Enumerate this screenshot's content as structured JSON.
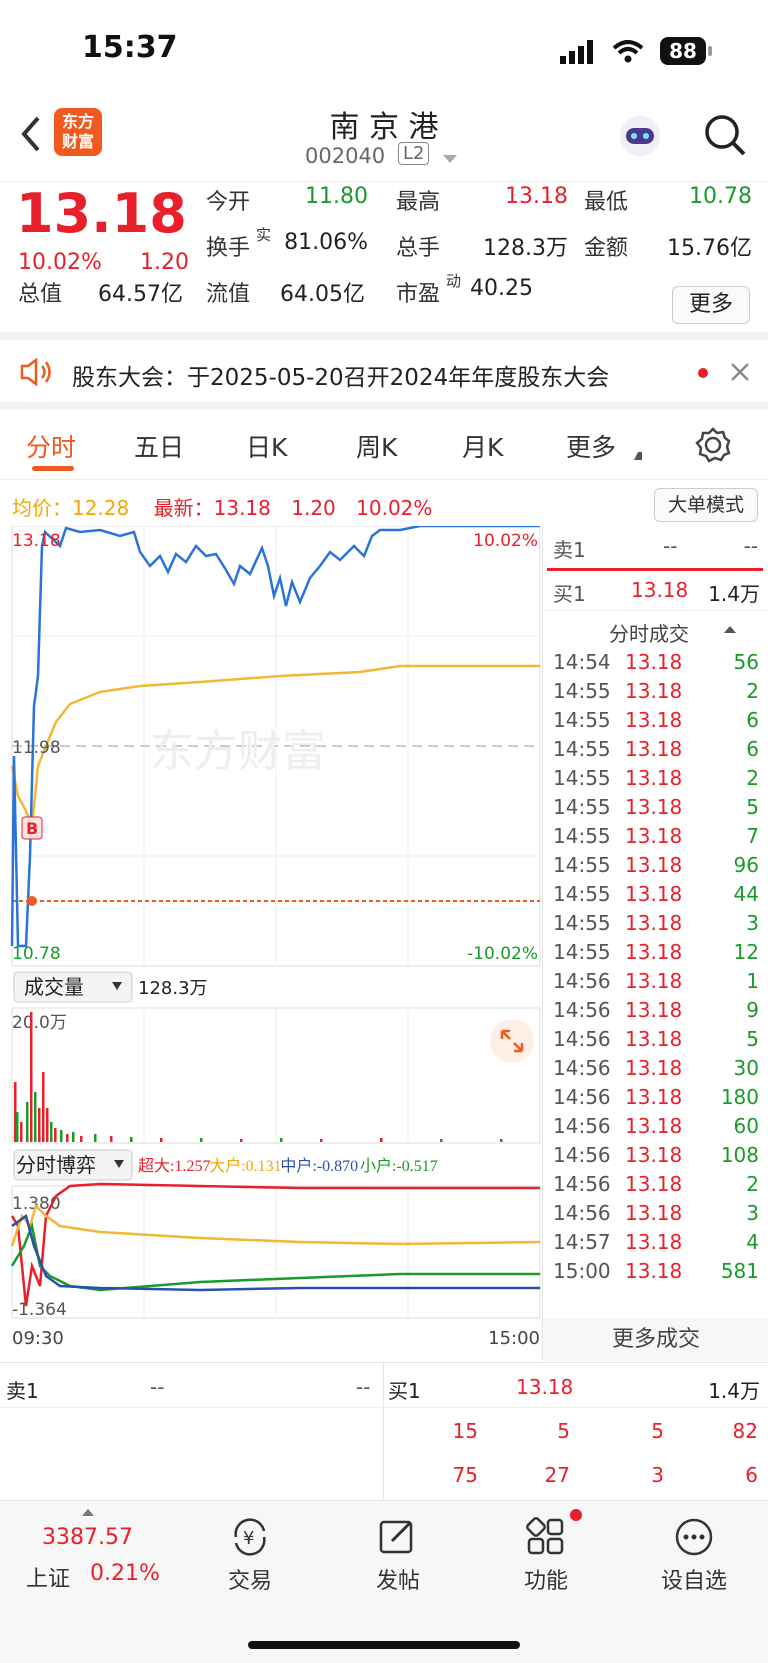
{
  "status_bar": {
    "time": "15:37",
    "battery": "88"
  },
  "header": {
    "title": "南 京 港",
    "code": "002040",
    "level_badge": "L2",
    "logo_text": "东方\n财富"
  },
  "quote": {
    "price": "13.18",
    "change_pct": "10.02%",
    "change": "1.20",
    "rows": [
      [
        {
          "label": "今开",
          "value": "11.80",
          "color": "green"
        },
        {
          "label": "最高",
          "value": "13.18",
          "color": "red"
        },
        {
          "label": "最低",
          "value": "10.78",
          "color": "green"
        }
      ],
      [
        {
          "label": "换手",
          "sup": "实",
          "value": "81.06%",
          "color": "dark"
        },
        {
          "label": "总手",
          "value": "128.3万",
          "color": "dark"
        },
        {
          "label": "金额",
          "value": "15.76亿",
          "color": "dark"
        }
      ],
      [
        {
          "label": "总值",
          "value": "64.57亿",
          "color": "dark"
        },
        {
          "label": "流值",
          "value": "64.05亿",
          "color": "dark"
        },
        {
          "label": "市盈",
          "sup": "动",
          "value": "40.25",
          "color": "dark"
        }
      ]
    ],
    "more_label": "更多"
  },
  "notice": {
    "text": "股东大会：于2025-05-20召开2024年年度股东大会"
  },
  "tabs": [
    {
      "label": "分时",
      "active": true
    },
    {
      "label": "五日"
    },
    {
      "label": "日K"
    },
    {
      "label": "周K"
    },
    {
      "label": "月K"
    },
    {
      "label": "更多"
    }
  ],
  "intraday": {
    "avg_label": "均价：",
    "avg_value": "12.28",
    "latest_label": "最新：",
    "latest_value": "13.18",
    "latest_change": "1.20",
    "latest_pct": "10.02%",
    "mode_button": "大单模式",
    "price_high": "13.18",
    "price_mid": "11.98",
    "price_low": "10.78",
    "pct_high": "10.02%",
    "pct_low": "-10.02%",
    "watermark": "东方财富",
    "buy_marker": "B",
    "volume_selector": "成交量",
    "volume_total": "128.3万",
    "volume_max": "20.0万",
    "flow_selector": "分时博弈",
    "flow": [
      {
        "label": "超大:",
        "value": "1.257",
        "color": "#e8202b"
      },
      {
        "label": "大户:",
        "value": "0.131",
        "color": "#f2a800"
      },
      {
        "label": "中户:",
        "value": "-0.870",
        "color": "#2a4fb0"
      },
      {
        "label": "小户:",
        "value": "-0.517",
        "color": "#1a9a2a"
      }
    ],
    "flow_high": "1.380",
    "flow_low": "-1.364",
    "time_start": "09:30",
    "time_end": "15:00"
  },
  "orderbook_side": {
    "sell1": {
      "label": "卖1",
      "price": "--",
      "volume": "--"
    },
    "buy1": {
      "label": "买1",
      "price": "13.18",
      "volume": "1.4万"
    },
    "ticks_title": "分时成交",
    "ticks": [
      {
        "time": "14:54",
        "price": "13.18",
        "vol": "56",
        "c": "green"
      },
      {
        "time": "14:55",
        "price": "13.18",
        "vol": "2",
        "c": "green"
      },
      {
        "time": "14:55",
        "price": "13.18",
        "vol": "6",
        "c": "green"
      },
      {
        "time": "14:55",
        "price": "13.18",
        "vol": "6",
        "c": "green"
      },
      {
        "time": "14:55",
        "price": "13.18",
        "vol": "2",
        "c": "green"
      },
      {
        "time": "14:55",
        "price": "13.18",
        "vol": "5",
        "c": "green"
      },
      {
        "time": "14:55",
        "price": "13.18",
        "vol": "7",
        "c": "green"
      },
      {
        "time": "14:55",
        "price": "13.18",
        "vol": "96",
        "c": "green"
      },
      {
        "time": "14:55",
        "price": "13.18",
        "vol": "44",
        "c": "green"
      },
      {
        "time": "14:55",
        "price": "13.18",
        "vol": "3",
        "c": "green"
      },
      {
        "time": "14:55",
        "price": "13.18",
        "vol": "12",
        "c": "green"
      },
      {
        "time": "14:56",
        "price": "13.18",
        "vol": "1",
        "c": "green"
      },
      {
        "time": "14:56",
        "price": "13.18",
        "vol": "9",
        "c": "green"
      },
      {
        "time": "14:56",
        "price": "13.18",
        "vol": "5",
        "c": "green"
      },
      {
        "time": "14:56",
        "price": "13.18",
        "vol": "30",
        "c": "green"
      },
      {
        "time": "14:56",
        "price": "13.18",
        "vol": "180",
        "c": "green"
      },
      {
        "time": "14:56",
        "price": "13.18",
        "vol": "60",
        "c": "green"
      },
      {
        "time": "14:56",
        "price": "13.18",
        "vol": "108",
        "c": "green"
      },
      {
        "time": "14:56",
        "price": "13.18",
        "vol": "2",
        "c": "green"
      },
      {
        "time": "14:56",
        "price": "13.18",
        "vol": "3",
        "c": "green"
      },
      {
        "time": "14:57",
        "price": "13.18",
        "vol": "4",
        "c": "green"
      },
      {
        "time": "15:00",
        "price": "13.18",
        "vol": "581",
        "c": "green"
      }
    ],
    "more_ticks": "更多成交"
  },
  "bottom_book": {
    "sell1_label": "卖1",
    "sell1_price": "--",
    "sell1_vol": "--",
    "buy1_label": "买1",
    "buy1_price": "13.18",
    "buy1_vol": "1.4万",
    "row2": [
      "15",
      "5",
      "5",
      "82"
    ],
    "row3": [
      "75",
      "27",
      "3",
      "6"
    ]
  },
  "bottom_nav": {
    "index_value": "3387.57",
    "index_name": "上证",
    "index_pct": "0.21%",
    "items": [
      {
        "label": "交易",
        "icon": "yen-cycle-icon"
      },
      {
        "label": "发帖",
        "icon": "edit-icon"
      },
      {
        "label": "功能",
        "icon": "grid-icon"
      },
      {
        "label": "设自选",
        "icon": "more-dots-icon"
      }
    ]
  }
}
